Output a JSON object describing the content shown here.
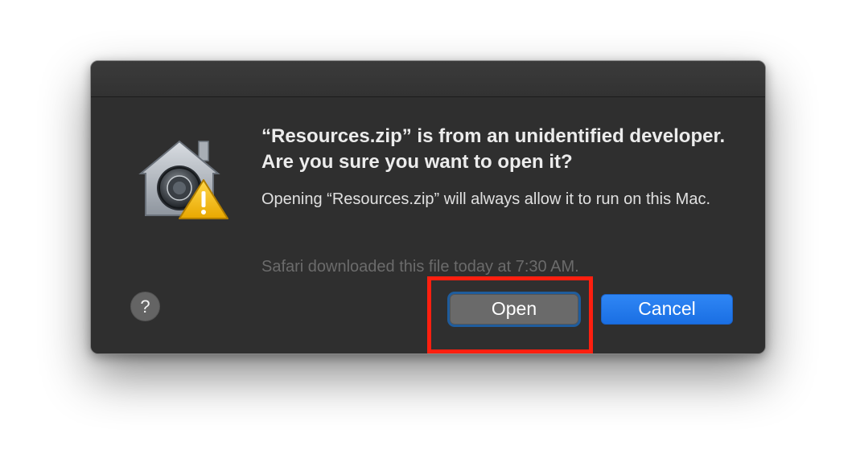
{
  "dialog": {
    "heading": "“Resources.zip” is from an unidentified developer. Are you sure you want to open it?",
    "body": "Opening “Resources.zip” will always allow it to run on this Mac.",
    "footnote": "Safari downloaded this file today at 7:30 AM.",
    "icon": "gatekeeper-security-icon",
    "warning_icon": "warning-triangle-icon"
  },
  "buttons": {
    "help_label": "?",
    "open_label": "Open",
    "cancel_label": "Cancel"
  },
  "annotation": {
    "highlight_color": "#ff1f0f",
    "highlight_target": "open-button"
  },
  "colors": {
    "dialog_background": "#2f2f2f",
    "accent_blue": "#1a6fe3",
    "warning_yellow": "#f5c518"
  }
}
